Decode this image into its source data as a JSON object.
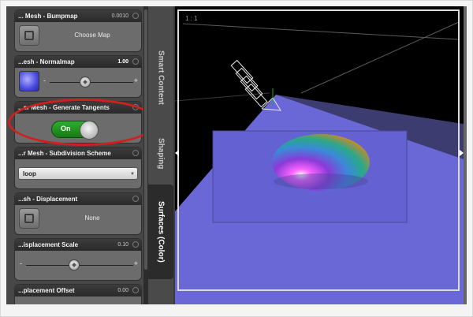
{
  "properties": [
    {
      "title": "... Mesh - Bumpmap",
      "value": "0.0010",
      "map_label": "Choose Map"
    },
    {
      "title": "...esh - Normalmap",
      "value": "1.00",
      "slider_minus": "-",
      "slider_plus": "+"
    },
    {
      "title": "...er Mesh - Generate Tangents",
      "toggle_label": "On",
      "toggle_on": true
    },
    {
      "title": "...r Mesh - Subdivision Scheme",
      "selected": "loop"
    },
    {
      "title": "...sh - Displacement",
      "map_label": "None"
    },
    {
      "title": "...isplacement Scale",
      "value": "0.10",
      "slider_minus": "-",
      "slider_plus": "+"
    },
    {
      "title": "...placement Offset",
      "value": "0.00"
    }
  ],
  "tabs": [
    {
      "label": "Smart Content"
    },
    {
      "label": "Shaping"
    },
    {
      "label": "Surfaces (Color)"
    }
  ],
  "viewport": {
    "label": "1 : 1"
  },
  "colors": {
    "highlight": "#cf1f1f",
    "toggle_on": "#1f9a1f",
    "plane": "#6a68d6"
  }
}
